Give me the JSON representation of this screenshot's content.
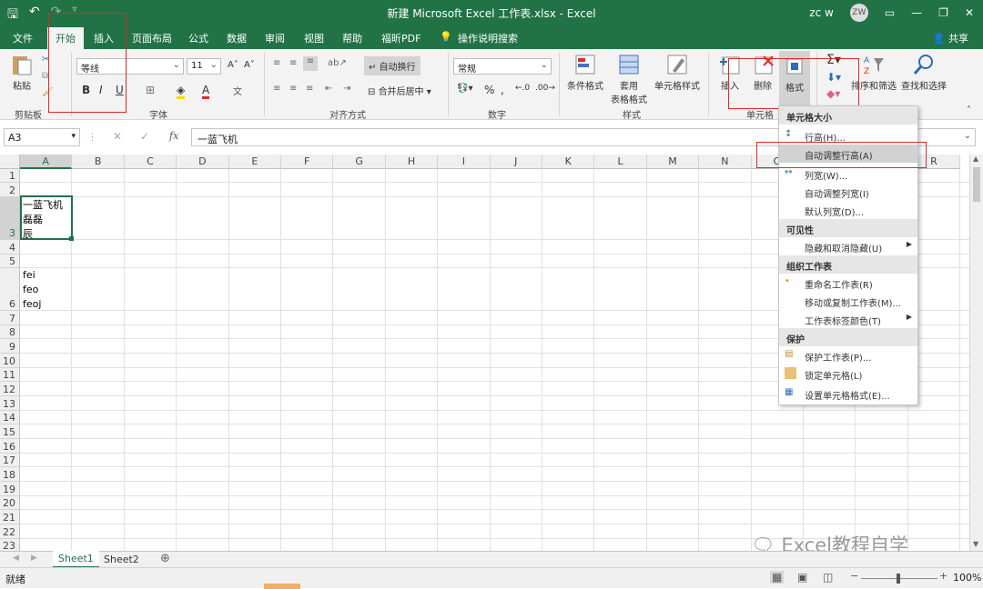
{
  "titlebar": {
    "title": "新建 Microsoft Excel 工作表.xlsx - Excel",
    "user": "zc w",
    "initials": "ZW"
  },
  "tabs": [
    "文件",
    "开始",
    "插入",
    "页面布局",
    "公式",
    "数据",
    "审阅",
    "视图",
    "帮助",
    "福昕PDF",
    "操作说明搜索"
  ],
  "share": "共享",
  "ribbon": {
    "paste": "粘贴",
    "clipboard": "剪贴板",
    "font_name": "等线",
    "font_size": "11",
    "font_group": "字体",
    "wrap": "自动换行",
    "merge": "合并后居中",
    "align_group": "对齐方式",
    "number_format": "常规",
    "number_group": "数字",
    "cond_format": "条件格式",
    "table_format_1": "套用",
    "table_format_2": "表格格式",
    "cell_style": "单元格样式",
    "style_group": "样式",
    "insert": "插入",
    "delete": "删除",
    "format": "格式",
    "cells_group": "单元格",
    "sort": "排序和筛选",
    "find": "查找和选择"
  },
  "formula": {
    "name_box": "A3",
    "content": "一蓝飞机"
  },
  "columns": [
    "A",
    "B",
    "C",
    "D",
    "E",
    "F",
    "G",
    "H",
    "I",
    "J",
    "K",
    "L",
    "M",
    "N",
    "O",
    "P",
    "Q",
    "R"
  ],
  "rows": [
    "1",
    "2",
    "3",
    "4",
    "5",
    "6",
    "7",
    "8",
    "9",
    "10",
    "11",
    "12",
    "13",
    "14",
    "15",
    "16",
    "17",
    "18",
    "19",
    "20",
    "21",
    "22",
    "23"
  ],
  "cells": {
    "a3_1": "一蓝飞机",
    "a3_2": "磊磊",
    "a3_3": "辰",
    "a6_1": "fei",
    "a6_2": "feo",
    "a6_3": "feoj"
  },
  "menu": {
    "h1": "单元格大小",
    "row_height": "行高(H)...",
    "autofit_row": "自动调整行高(A)",
    "col_width": "列宽(W)...",
    "autofit_col": "自动调整列宽(I)",
    "default_width": "默认列宽(D)...",
    "h2": "可见性",
    "hide": "隐藏和取消隐藏(U)",
    "h3": "组织工作表",
    "rename": "重命名工作表(R)",
    "move_copy": "移动或复制工作表(M)...",
    "tab_color": "工作表标签颜色(T)",
    "h4": "保护",
    "protect": "保护工作表(P)...",
    "lock": "锁定单元格(L)",
    "format_cells": "设置单元格格式(E)..."
  },
  "sheets": [
    "Sheet1",
    "Sheet2"
  ],
  "watermark": "Excel教程自学",
  "status": {
    "ready": "就绪",
    "zoom": "100%"
  }
}
